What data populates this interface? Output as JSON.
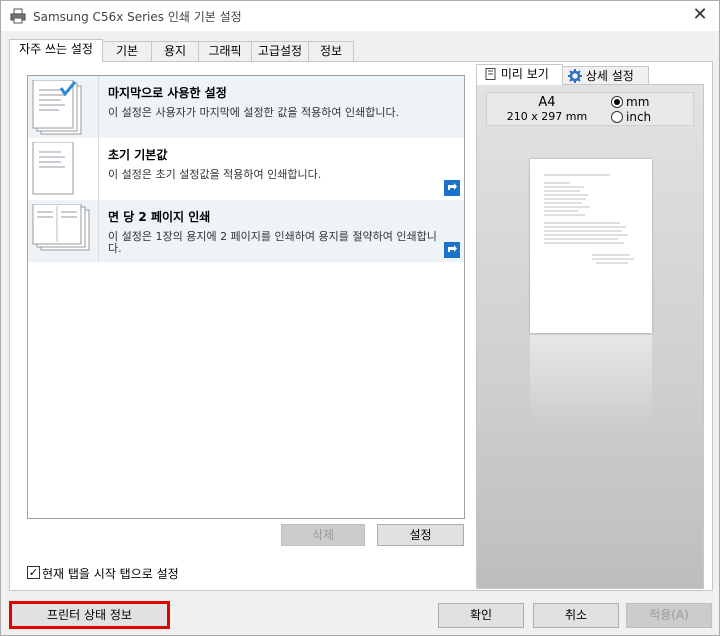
{
  "window": {
    "title": "Samsung C56x Series 인쇄 기본 설정",
    "close_glyph": "✕"
  },
  "tabs": [
    "자주 쓰는 설정",
    "기본",
    "용지",
    "그래픽",
    "고급설정",
    "정보"
  ],
  "favorites": [
    {
      "name": "마지막으로 사용한 설정",
      "desc": "이 설정은 사용자가 마지막에 설정한 값을 적용하여 인쇄합니다."
    },
    {
      "name": "초기 기본값",
      "desc": "이 설정은 초기 설정값을 적용하여 인쇄합니다."
    },
    {
      "name": "면 당 2 페이지 인쇄",
      "desc": "이 설정은 1장의 용지에 2 페이지를 인쇄하여 용지를 절약하여 인쇄합니다."
    }
  ],
  "list_buttons": {
    "delete": "삭제",
    "settings": "설정"
  },
  "startup_checkbox": {
    "label": "현재 탭을 시작 탭으로 설정",
    "checked": true
  },
  "preview": {
    "tabs": [
      "미리 보기",
      "상세 설정"
    ],
    "paper_size": "A4",
    "paper_dims": "210 x 297 mm",
    "units": [
      "mm",
      "inch"
    ],
    "selected_unit": "mm"
  },
  "bottom": {
    "status_button": "프린터 상태 정보",
    "ok": "확인",
    "cancel": "취소",
    "apply": "적용(A)"
  },
  "colors": {
    "highlight_border": "#e00000",
    "item_shade": "#eef3f8",
    "accent_blue": "#1a73c8"
  }
}
